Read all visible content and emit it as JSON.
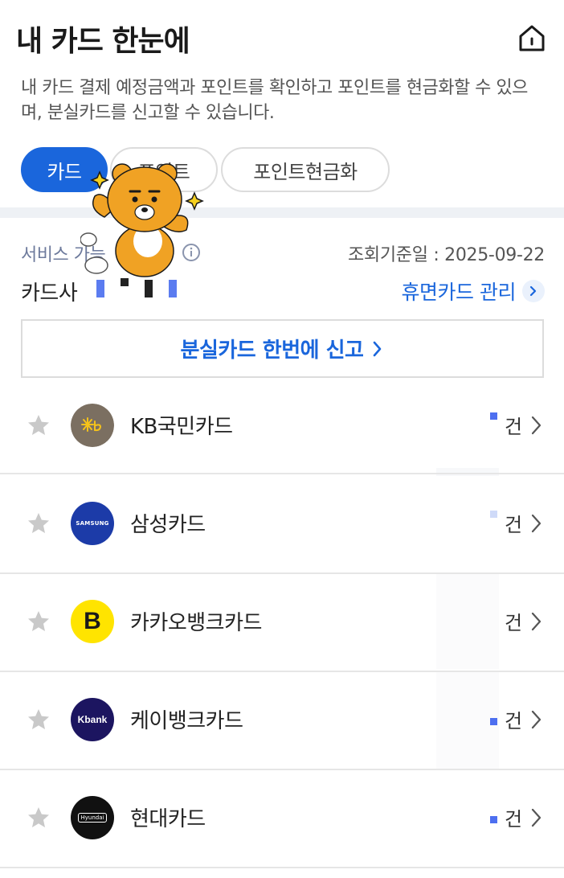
{
  "header": {
    "title": "내 카드 한눈에"
  },
  "description": "내 카드 결제 예정금액과 포인트를 확인하고 포인트를 현금화할 수 있으며, 분실카드를 신고할 수 있습니다.",
  "tabs": [
    {
      "label": "카드",
      "active": true
    },
    {
      "label": "포인트",
      "active": false
    },
    {
      "label": "포인트현금화",
      "active": false
    }
  ],
  "meta": {
    "service_label": "서비스 가능",
    "base_date": "조회기준일 : 2025-09-22"
  },
  "card_section": {
    "company_label": "카드사",
    "dormant_link": "휴면카드 관리"
  },
  "report_button": {
    "label": "분실카드 한번에 신고"
  },
  "cards": [
    {
      "name": "KB국민카드",
      "logo_text": "KB",
      "logo_bg": "#7b6f61",
      "logo_fg": "#f5c21a",
      "unit": "건"
    },
    {
      "name": "삼성카드",
      "logo_text": "SAMSUNG",
      "logo_bg": "#1c3ba8",
      "logo_fg": "#ffffff",
      "unit": "건"
    },
    {
      "name": "카카오뱅크카드",
      "logo_text": "B",
      "logo_bg": "#ffe400",
      "logo_fg": "#1a1a1a",
      "unit": "건"
    },
    {
      "name": "케이뱅크카드",
      "logo_text": "Kbank",
      "logo_bg": "#1c1560",
      "logo_fg": "#ffffff",
      "unit": "건"
    },
    {
      "name": "현대카드",
      "logo_text": "Hyundai",
      "logo_bg": "#111111",
      "logo_fg": "#ffffff",
      "unit": "건"
    }
  ],
  "colors": {
    "accent": "#1a66dc",
    "tab_active_bg": "#1a66dc",
    "divider": "#eef1f5"
  }
}
